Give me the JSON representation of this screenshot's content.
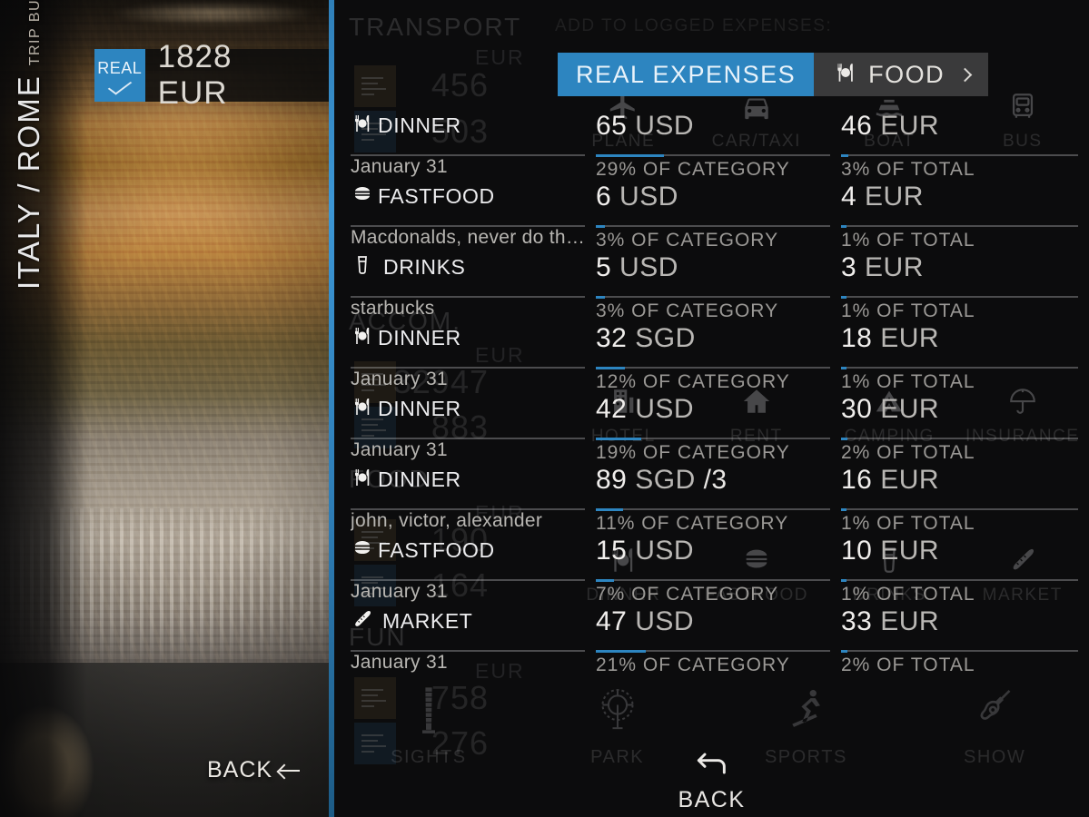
{
  "trip": {
    "title": "ITALY / ROME",
    "subtitle": "TRIP BUDGET BETA",
    "mode_badge": "REAL",
    "total": "1828 EUR",
    "back_label": "BACK"
  },
  "tabs": {
    "real_expenses": "REAL EXPENSES",
    "category": "FOOD",
    "category_icon": "cutlery-icon",
    "chevron": "chevron-right-icon"
  },
  "ghost": {
    "add_to_logged": "ADD TO LOGGED EXPENSES:",
    "categories": [
      {
        "name": "TRANSPORT",
        "currency": "EUR",
        "planned": "456",
        "real": "503",
        "subcategories": [
          {
            "label": "PLANE",
            "icon": "plane-icon"
          },
          {
            "label": "CAR/TAXI",
            "icon": "car-icon"
          },
          {
            "label": "BOAT",
            "icon": "boat-icon"
          },
          {
            "label": "BUS",
            "icon": "bus-icon"
          }
        ]
      },
      {
        "name": "ACCOM.",
        "currency": "EUR",
        "planned": "32947",
        "real": "883",
        "subcategories": [
          {
            "label": "HOTEL",
            "icon": "hotel-icon"
          },
          {
            "label": "RENT",
            "icon": "house-icon"
          },
          {
            "label": "CAMPING",
            "icon": "tent-icon"
          },
          {
            "label": "INSURANCE",
            "icon": "umbrella-icon"
          }
        ]
      },
      {
        "name": "FOOD",
        "currency": "EUR",
        "planned": "190",
        "real": "164",
        "subcategories": [
          {
            "label": "DINNER",
            "icon": "cutlery-icon"
          },
          {
            "label": "FASTFOOD",
            "icon": "burger-icon"
          },
          {
            "label": "DRINKS",
            "icon": "beer-icon"
          },
          {
            "label": "MARKET",
            "icon": "bread-icon"
          }
        ]
      },
      {
        "name": "FUN",
        "currency": "EUR",
        "planned": "758",
        "real": "276",
        "subcategories": [
          {
            "label": "SIGHTS",
            "icon": "tower-icon"
          },
          {
            "label": "PARK",
            "icon": "ferris-wheel-icon"
          },
          {
            "label": "SPORTS",
            "icon": "skier-icon"
          },
          {
            "label": "SHOW",
            "icon": "guitar-icon"
          }
        ]
      }
    ]
  },
  "expenses": [
    {
      "category": "DINNER",
      "icon": "cutlery-icon",
      "note": "January 31",
      "amount": "65",
      "unit": "USD",
      "split": "",
      "pct_category": "29% OF CATEGORY",
      "pct_total": "3% OF TOTAL",
      "converted": "46",
      "converted_unit": "EUR",
      "bar_category_pct": 29,
      "bar_total_pct": 3
    },
    {
      "category": "FASTFOOD",
      "icon": "burger-icon",
      "note": "Macdonalds, never do that a…",
      "amount": "6",
      "unit": "USD",
      "split": "",
      "pct_category": "3% OF CATEGORY",
      "pct_total": "1% OF TOTAL",
      "converted": "4",
      "converted_unit": "EUR",
      "bar_category_pct": 3,
      "bar_total_pct": 1
    },
    {
      "category": "DRINKS",
      "icon": "beer-icon",
      "note": "starbucks",
      "amount": "5",
      "unit": "USD",
      "split": "",
      "pct_category": "3% OF CATEGORY",
      "pct_total": "1% OF TOTAL",
      "converted": "3",
      "converted_unit": "EUR",
      "bar_category_pct": 3,
      "bar_total_pct": 1
    },
    {
      "category": "DINNER",
      "icon": "cutlery-icon",
      "note": "January 31",
      "amount": "32",
      "unit": "SGD",
      "split": "",
      "pct_category": "12% OF CATEGORY",
      "pct_total": "1% OF TOTAL",
      "converted": "18",
      "converted_unit": "EUR",
      "bar_category_pct": 12,
      "bar_total_pct": 1
    },
    {
      "category": "DINNER",
      "icon": "cutlery-icon",
      "note": "January 31",
      "amount": "42",
      "unit": "USD",
      "split": "",
      "pct_category": "19% OF CATEGORY",
      "pct_total": "2% OF TOTAL",
      "converted": "30",
      "converted_unit": "EUR",
      "bar_category_pct": 19,
      "bar_total_pct": 2
    },
    {
      "category": "DINNER",
      "icon": "cutlery-icon",
      "note": "john, victor, alexander",
      "amount": "89",
      "unit": "SGD",
      "split": "/3",
      "pct_category": "11% OF CATEGORY",
      "pct_total": "1% OF TOTAL",
      "converted": "16",
      "converted_unit": "EUR",
      "bar_category_pct": 11,
      "bar_total_pct": 1
    },
    {
      "category": "FASTFOOD",
      "icon": "burger-icon",
      "note": "January 31",
      "amount": "15",
      "unit": "USD",
      "split": "",
      "pct_category": "7% OF CATEGORY",
      "pct_total": "1% OF TOTAL",
      "converted": "10",
      "converted_unit": "EUR",
      "bar_category_pct": 7,
      "bar_total_pct": 1
    },
    {
      "category": "MARKET",
      "icon": "bread-icon",
      "note": "January 31",
      "amount": "47",
      "unit": "USD",
      "split": "",
      "pct_category": "21% OF CATEGORY",
      "pct_total": "2% OF TOTAL",
      "converted": "33",
      "converted_unit": "EUR",
      "bar_category_pct": 21,
      "bar_total_pct": 2
    }
  ],
  "bottom": {
    "back_label": "BACK",
    "back_icon": "arrow-left-icon"
  },
  "colors": {
    "accent": "#2d85c0",
    "panel_bg": "#0c0c0d",
    "tab_inactive": "#3a3a3b",
    "text_primary": "#f0eeec",
    "text_muted": "#9a9895"
  }
}
